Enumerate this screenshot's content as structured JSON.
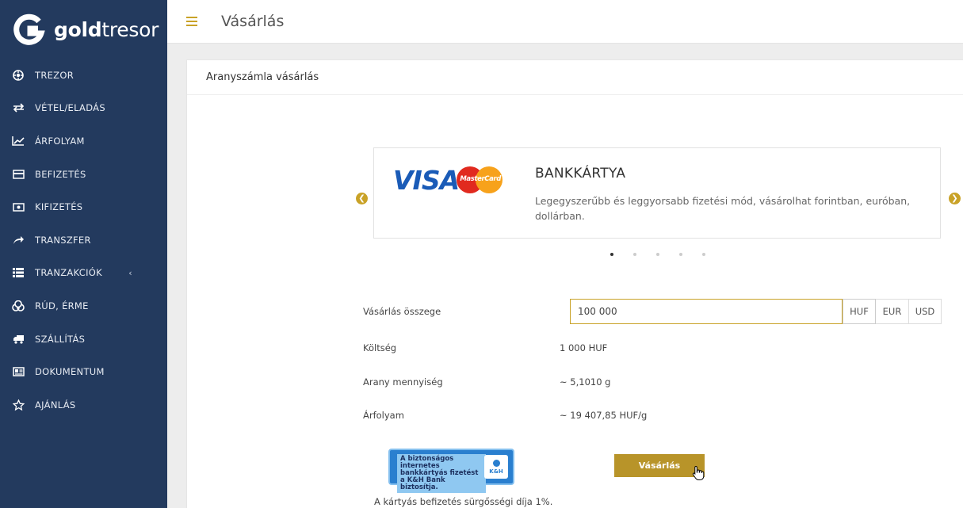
{
  "brand": {
    "bold": "gold",
    "light": "tresor"
  },
  "header": {
    "title": "Vásárlás"
  },
  "sidebar": {
    "items": [
      {
        "label": "TREZOR",
        "icon": "vault-icon"
      },
      {
        "label": "VÉTEL/ELADÁS",
        "icon": "exchange-icon"
      },
      {
        "label": "ÁRFOLYAM",
        "icon": "chart-icon"
      },
      {
        "label": "BEFIZETÉS",
        "icon": "credit-card-icon"
      },
      {
        "label": "KIFIZETÉS",
        "icon": "money-icon"
      },
      {
        "label": "TRANSZFER",
        "icon": "share-arrow-icon"
      },
      {
        "label": "TRANZAKCIÓK",
        "icon": "list-icon",
        "caret": "‹"
      },
      {
        "label": "RÚD, ÉRME",
        "icon": "coins-icon"
      },
      {
        "label": "SZÁLLÍTÁS",
        "icon": "truck-icon"
      },
      {
        "label": "DOKUMENTUM",
        "icon": "document-icon"
      },
      {
        "label": "AJÁNLÁS",
        "icon": "star-icon"
      }
    ]
  },
  "panel": {
    "title": "Aranyszámla vásárlás"
  },
  "carousel": {
    "title": "BANKKÁRTYA",
    "text": "Legegyszerűbb és leggyorsabb fizetési mód, vásárolhat forintban, euróban, dollárban.",
    "logo_visa": "VISA",
    "logo_mc": "MasterCard",
    "active_slide": 1,
    "slide_count": 5
  },
  "form": {
    "amount_label": "Vásárlás összege",
    "amount_value": "100 000",
    "currencies": [
      "HUF",
      "EUR",
      "USD"
    ],
    "selected_currency": "HUF",
    "cost_label": "Költség",
    "cost_value": "1 000  HUF",
    "gold_label": "Arany mennyiség",
    "gold_value": "~ 5,1010  g",
    "rate_label": "Árfolyam",
    "rate_value": "~ 19 407,85  HUF/g",
    "buy_button": "Vásárlás",
    "fee_note": "A kártyás befizetés sürgősségi díja 1%."
  },
  "kh_badge": {
    "text": "A biztonságos internetes bankkártyás fizetést a K&H Bank biztosítja.",
    "logo": "K&H"
  },
  "colors": {
    "accent": "#c9a227",
    "sidebar": "#233a5e",
    "button": "#b89429"
  }
}
